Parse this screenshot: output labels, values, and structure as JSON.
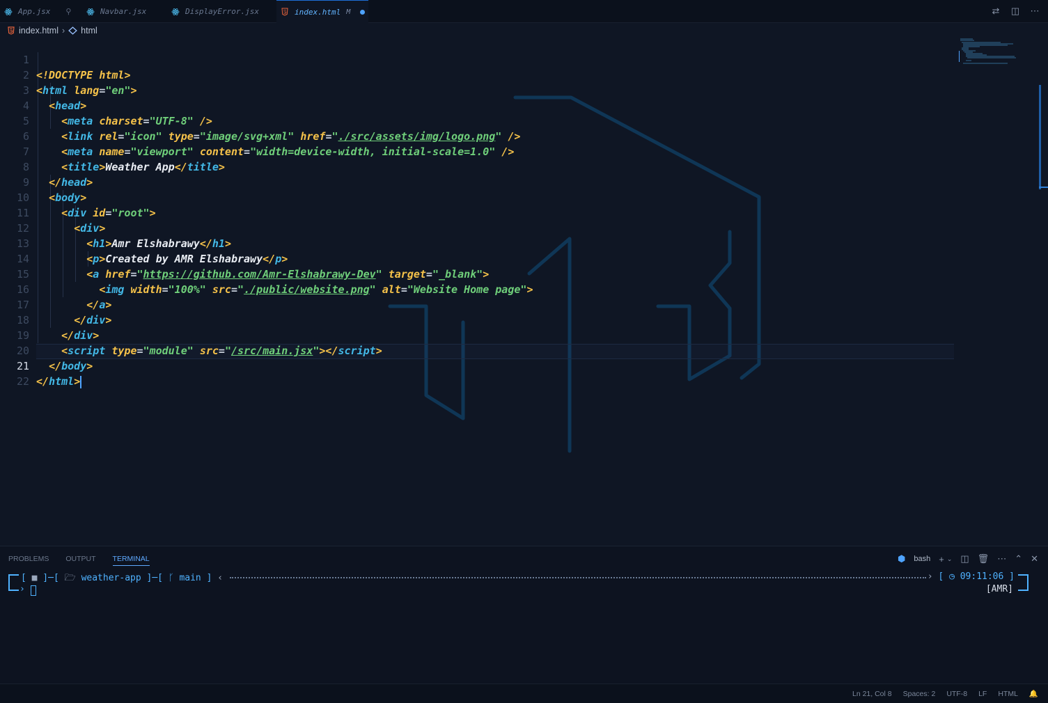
{
  "tabs": [
    {
      "label": "App.jsx",
      "icon": "react-icon",
      "pinned": true
    },
    {
      "label": "Navbar.jsx",
      "icon": "react-icon"
    },
    {
      "label": "DisplayError.jsx",
      "icon": "react-icon"
    },
    {
      "label": "index.html",
      "icon": "html5-icon",
      "modified": "M",
      "active": true
    }
  ],
  "breadcrumb": {
    "file": "index.html",
    "symbol": "html"
  },
  "lines": [
    {
      "n": "1"
    },
    {
      "n": "2"
    },
    {
      "n": "3"
    },
    {
      "n": "4"
    },
    {
      "n": "5"
    },
    {
      "n": "6"
    },
    {
      "n": "7"
    },
    {
      "n": "8"
    },
    {
      "n": "9"
    },
    {
      "n": "10"
    },
    {
      "n": "11"
    },
    {
      "n": "12"
    },
    {
      "n": "13"
    },
    {
      "n": "14"
    },
    {
      "n": "15"
    },
    {
      "n": "16"
    },
    {
      "n": "17"
    },
    {
      "n": "18"
    },
    {
      "n": "19"
    },
    {
      "n": "20"
    },
    {
      "n": "21"
    },
    {
      "n": "22"
    }
  ],
  "code": {
    "doctype": "!DOCTYPE",
    "html": "html",
    "lang_attr": "lang",
    "lang_val": "\"en\"",
    "head": "head",
    "meta": "meta",
    "charset_attr": "charset",
    "charset_val": "\"UTF-8\"",
    "link": "link",
    "rel_attr": "rel",
    "rel_val": "\"icon\"",
    "type_attr": "type",
    "type_val": "\"image/svg+xml\"",
    "href_attr": "href",
    "logo_href": "./src/assets/img/logo.png",
    "name_attr": "name",
    "name_val": "\"viewport\"",
    "content_attr": "content",
    "content_val": "\"width=device-width, initial-scale=1.0\"",
    "title": "title",
    "title_text": "Weather App",
    "body": "body",
    "div": "div",
    "id_attr": "id",
    "id_val": "\"root\"",
    "h1": "h1",
    "h1_text": "Amr Elshabrawy",
    "p": "p",
    "p_text": "Created by AMR Elshabrawy",
    "a": "a",
    "a_href": "https://github.com/Amr-Elshabrawy-Dev",
    "target_attr": "target",
    "target_val": "\"_blank\"",
    "img": "img",
    "width_attr": "width",
    "width_val": "\"100%\"",
    "src_attr": "src",
    "img_src": "./public/website.png",
    "alt_attr": "alt",
    "alt_val": "\"Website Home page\"",
    "script": "script",
    "module_val": "\"module\"",
    "script_src": "/src/main.jsx"
  },
  "panel": {
    "tabs": [
      "PROBLEMS",
      "OUTPUT",
      "TERMINAL"
    ],
    "active_tab": "TERMINAL",
    "shell": "bash"
  },
  "terminal": {
    "dir": "weather-app",
    "branch": "main",
    "time": "09:11:06",
    "user": "[AMR]"
  },
  "status": {
    "position": "Ln 21, Col 8",
    "spaces": "Spaces: 2",
    "encoding": "UTF-8",
    "eol": "LF",
    "language": "HTML"
  },
  "colors": {
    "accent": "#4ea3ff",
    "tag": "#f5c24a",
    "tagname": "#43b8e6",
    "string": "#6fcf7a",
    "background": "#0f1624"
  }
}
